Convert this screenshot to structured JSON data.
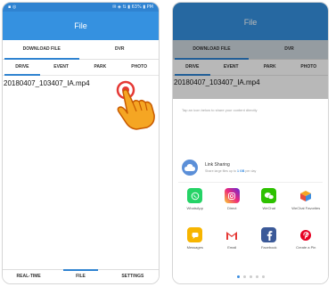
{
  "left": {
    "statusbar": {
      "left": "▪ ◎",
      "right": "✉ ◈ ⇅ ▮ 63% ▮ PM"
    },
    "title": "File",
    "top_tabs": [
      {
        "label": "DOWNLOAD FILE"
      },
      {
        "label": "DVR"
      }
    ],
    "sub_tabs": [
      {
        "label": "DRIVE"
      },
      {
        "label": "EVENT"
      },
      {
        "label": "PARK"
      },
      {
        "label": "PHOTO"
      }
    ],
    "file_name": "20180407_103407_IA.mp4",
    "bottom_nav": [
      {
        "label": "REAL-TIME"
      },
      {
        "label": "FILE"
      },
      {
        "label": "SETTINGS"
      }
    ]
  },
  "right": {
    "title": "File",
    "top_tabs": [
      {
        "label": "DOWNLOAD FILE"
      },
      {
        "label": "DVR"
      }
    ],
    "sub_tabs": [
      {
        "label": "DRIVE"
      },
      {
        "label": "EVENT"
      },
      {
        "label": "PARK"
      },
      {
        "label": "PHOTO"
      }
    ],
    "file_name": "20180407_103407_IA.mp4",
    "share": {
      "hint": "Tap an icon below to share your content directly",
      "link_title": "Link Sharing",
      "link_sub_prefix": "Share large files up to",
      "link_sub_size": "1 GB",
      "link_sub_suffix": "per day",
      "apps_row1": [
        {
          "label": "WhatsApp",
          "icon": "whatsapp-icon",
          "color": "#25d366"
        },
        {
          "label": "Direct",
          "icon": "instagram-direct-icon",
          "color": "#d6249f"
        },
        {
          "label": "WeChat",
          "icon": "wechat-icon",
          "color": "#2dc100"
        },
        {
          "label": "WeChat Favorites",
          "icon": "wechat-favorites-icon",
          "color": "#f5a623"
        }
      ],
      "apps_row2": [
        {
          "label": "Messages",
          "icon": "messages-icon",
          "color": "#f7b500"
        },
        {
          "label": "Email",
          "icon": "email-icon",
          "color": "#e53935"
        },
        {
          "label": "Facebook",
          "icon": "facebook-icon",
          "color": "#3b5998"
        },
        {
          "label": "Create a Pin",
          "icon": "pinterest-icon",
          "color": "#e60023"
        }
      ]
    }
  },
  "colors": {
    "accent": "#2f83d1",
    "appbar": "#3591e0",
    "hand": "#f5a623",
    "tap_ring": "#e53935"
  }
}
